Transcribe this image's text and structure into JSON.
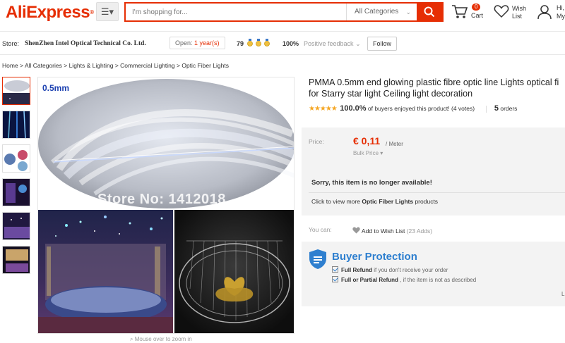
{
  "header": {
    "logo": "AliExpress",
    "search_placeholder": "I'm shopping for...",
    "category": "All Categories",
    "cart_count": "0",
    "cart_label": "Cart",
    "wish_line1": "Wish",
    "wish_line2": "List",
    "account_line1": "Hi,",
    "account_line2": "My"
  },
  "store": {
    "label": "Store:",
    "name": "ShenZhen Intel Optical Technical Co. Ltd.",
    "open_prefix": "Open:",
    "open_years": "1 year(s)",
    "score": "79",
    "feedback_pct": "100%",
    "feedback_label": "Positive feedback",
    "follow_label": "Follow"
  },
  "breadcrumb": {
    "items": [
      "Home",
      "All Categories",
      "Lights & Lighting",
      "Commercial Lighting",
      "Optic Fiber Lights"
    ],
    "separator": ">"
  },
  "gallery": {
    "label_thickness": "0.5mm",
    "watermark": "Store No: 1412018",
    "zoom_hint": "Mouse over to zoom in"
  },
  "product": {
    "title_line1": "PMMA 0.5mm end glowing plastic fibre optic line Lights optical fi",
    "title_line2": "for Starry star light Ceiling light decoration",
    "stars": "★★★★★",
    "rating_pct": "100.0%",
    "rating_text": "of buyers enjoyed this product! (4 votes)",
    "orders_num": "5",
    "orders_label": "orders"
  },
  "price": {
    "label": "Price:",
    "value": "€ 0,11",
    "unit": "/ Meter",
    "bulk": "Bulk Price",
    "unavailable": "Sorry, this item is no longer available!",
    "viewmore_prefix": "Click to view more",
    "viewmore_link": "Optic Fiber Lights",
    "viewmore_suffix": "products"
  },
  "actions": {
    "youcan": "You can:",
    "wishlist": "Add to Wish List",
    "wishlist_count": "(23 Adds)"
  },
  "protection": {
    "title": "Buyer Protection",
    "row1_bold": "Full Refund",
    "row1_rest": "if you don't receive your order",
    "row2_bold": "Full or Partial Refund",
    "row2_rest": ", if the item is not as described",
    "cut": "L"
  },
  "colors": {
    "brand": "#e62e04",
    "protect_blue": "#2e7fcf",
    "star": "#f5a623"
  }
}
